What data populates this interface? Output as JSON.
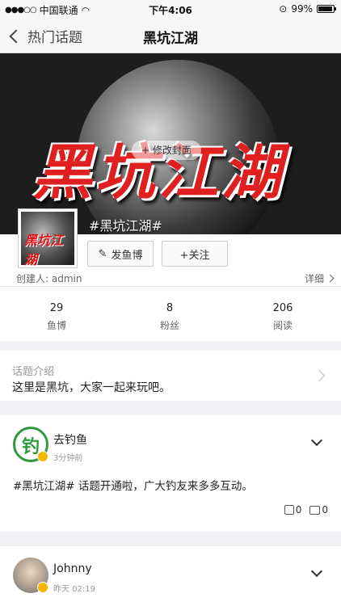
{
  "status": {
    "carrier": "中国联通",
    "time": "下午4:06",
    "battery": "99%"
  },
  "nav": {
    "back_label": "热门话题",
    "title": "黑坑江湖"
  },
  "cover": {
    "art_text": "黑坑江湖",
    "change_label": "+ 修改封面"
  },
  "topic": {
    "name": "#黑坑江湖#",
    "thumb_text": "黑坑江湖"
  },
  "actions": {
    "post_label": "发鱼博",
    "follow_label": "+关注"
  },
  "creator": "创建人: admin",
  "detail_label": "详细",
  "stats": [
    {
      "value": "29",
      "label": "鱼博"
    },
    {
      "value": "8",
      "label": "粉丝"
    },
    {
      "value": "206",
      "label": "阅读"
    }
  ],
  "intro": {
    "label": "话题介绍",
    "text": "这里是黑坑，大家一起来玩吧。"
  },
  "posts": [
    {
      "author": "去钓鱼",
      "time": "3分钟前",
      "body": "#黑坑江湖# 话题开通啦，广大钓友来多多互动。",
      "likes": "0",
      "comments": "0"
    },
    {
      "author": "Johnny",
      "time": "昨天 02:19"
    }
  ],
  "colors": {
    "accent_green": "#2e9a3d",
    "cover_red": "#e02020",
    "badge": "#f5b800"
  }
}
